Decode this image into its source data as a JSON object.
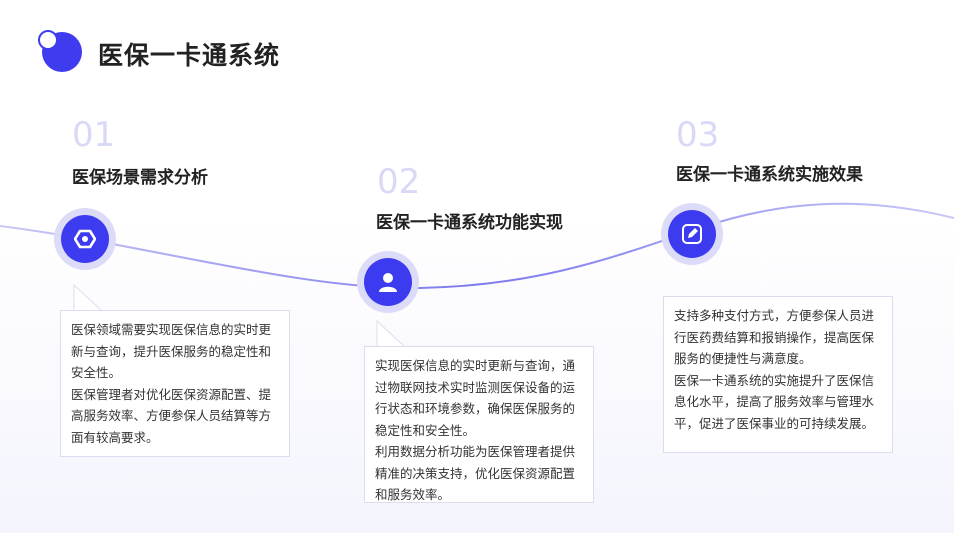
{
  "title": "医保一卡通系统",
  "steps": [
    {
      "num": "01",
      "title": "医保场景需求分析",
      "icon": "hexagon-nut-icon",
      "paragraphs": [
        "医保领域需要实现医保信息的实时更新与查询，提升医保服务的稳定性和安全性。",
        "医保管理者对优化医保资源配置、提高服务效率、方便参保人员结算等方面有较高要求。"
      ]
    },
    {
      "num": "02",
      "title": "医保一卡通系统功能实现",
      "icon": "user-icon",
      "paragraphs": [
        "实现医保信息的实时更新与查询，通过物联网技术实时监测医保设备的运行状态和环境参数，确保医保服务的稳定性和安全性。",
        "利用数据分析功能为医保管理者提供精准的决策支持，优化医保资源配置和服务效率。"
      ]
    },
    {
      "num": "03",
      "title": "医保一卡通系统实施效果",
      "icon": "edit-icon",
      "paragraphs": [
        "支持多种支付方式，方便参保人员进行医药费结算和报销操作，提高医保服务的便捷性与满意度。",
        "医保一卡通系统的实施提升了医保信息化水平，提高了服务效率与管理水平，促进了医保事业的可持续发展。"
      ]
    }
  ],
  "colors": {
    "accent": "#3d3bf0",
    "node_ring": "#dcdcf8",
    "number": "#d7d9f7"
  }
}
